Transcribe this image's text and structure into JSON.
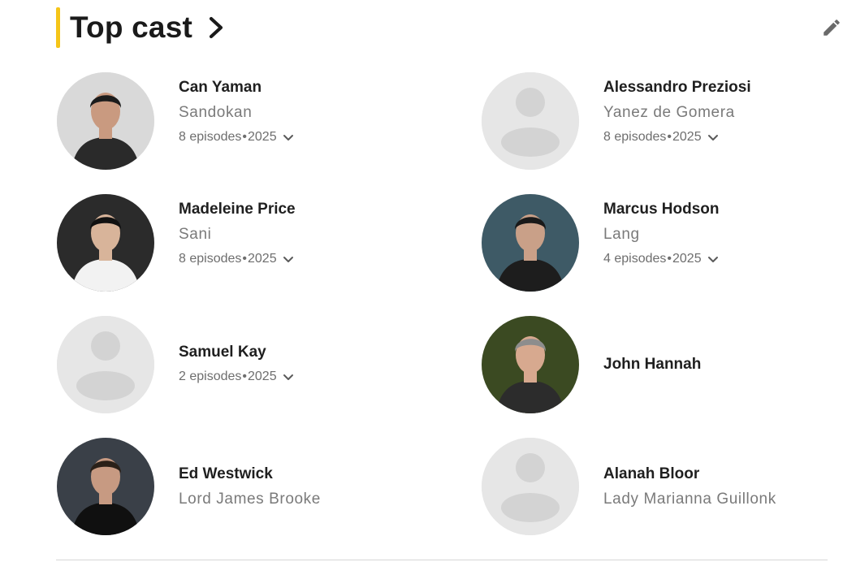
{
  "section": {
    "title": "Top cast",
    "accent_color": "#f5c518"
  },
  "cast": [
    {
      "name": "Can Yaman",
      "role": "Sandokan",
      "episodes": "8 episodes",
      "year": "2025",
      "photo": "photo"
    },
    {
      "name": "Alessandro Preziosi",
      "role": "Yanez de Gomera",
      "episodes": "8 episodes",
      "year": "2025",
      "photo": "placeholder"
    },
    {
      "name": "Madeleine Price",
      "role": "Sani",
      "episodes": "8 episodes",
      "year": "2025",
      "photo": "photo"
    },
    {
      "name": "Marcus Hodson",
      "role": "Lang",
      "episodes": "4 episodes",
      "year": "2025",
      "photo": "photo"
    },
    {
      "name": "Samuel Kay",
      "role": "",
      "episodes": "2 episodes",
      "year": "2025",
      "photo": "placeholder"
    },
    {
      "name": "John Hannah",
      "role": "",
      "episodes": "",
      "year": "",
      "photo": "photo"
    },
    {
      "name": "Ed Westwick",
      "role": "Lord James Brooke",
      "episodes": "",
      "year": "",
      "photo": "photo"
    },
    {
      "name": "Alanah Bloor",
      "role": "Lady Marianna Guillonk",
      "episodes": "",
      "year": "",
      "photo": "placeholder"
    }
  ],
  "icons": {
    "edit": "pencil-icon",
    "more": "chevron-right-icon",
    "expand": "chevron-down-icon"
  }
}
